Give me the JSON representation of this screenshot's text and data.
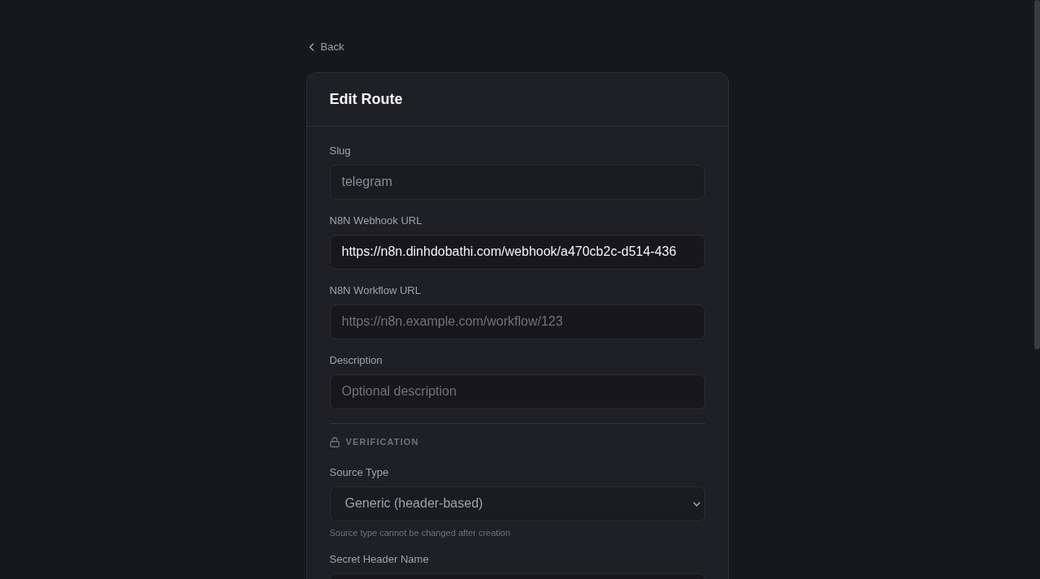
{
  "back_link": {
    "label": "Back"
  },
  "card": {
    "title": "Edit Route"
  },
  "fields": [
    {
      "kind": "input",
      "label": "Slug",
      "value": "telegram",
      "disabled": true
    },
    {
      "kind": "input",
      "label": "N8N Webhook URL",
      "value": "https://n8n.dinhdobathi.com/webhook/a470cb2c-d514-436",
      "disabled": false
    },
    {
      "kind": "input",
      "label": "N8N Workflow URL",
      "placeholder": "https://n8n.example.com/workflow/123",
      "disabled": false
    },
    {
      "kind": "input",
      "label": "Description",
      "placeholder": "Optional description",
      "disabled": false
    }
  ],
  "verification": {
    "heading": "VERIFICATION",
    "fields": [
      {
        "kind": "select",
        "label": "Source Type",
        "value": "Generic (header-based)",
        "disabled": true,
        "help": "Source type cannot be changed after creation"
      },
      {
        "kind": "input",
        "label": "Secret Header Name"
      }
    ]
  }
}
